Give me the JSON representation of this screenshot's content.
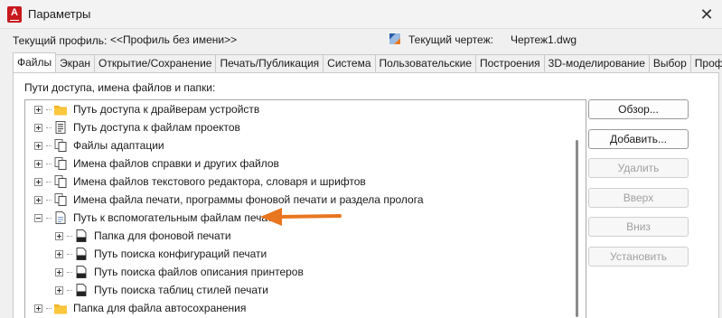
{
  "window": {
    "title": "Параметры",
    "app_icon_letter": "A",
    "close_glyph": "✕"
  },
  "header": {
    "profile_label": "Текущий профиль:",
    "profile_value": "<<Профиль без имени>>",
    "drawing_label": "Текущий чертеж:",
    "drawing_value": "Чертеж1.dwg"
  },
  "tabs": [
    {
      "label": "Файлы",
      "active": true
    },
    {
      "label": "Экран"
    },
    {
      "label": "Открытие/Сохранение"
    },
    {
      "label": "Печать/Публикация"
    },
    {
      "label": "Система"
    },
    {
      "label": "Пользовательские"
    },
    {
      "label": "Построения"
    },
    {
      "label": "3D-моделирование"
    },
    {
      "label": "Выбор"
    },
    {
      "label": "Профили"
    }
  ],
  "panel": {
    "label": "Пути доступа, имена файлов и папки:"
  },
  "tree": {
    "items": [
      {
        "label": "Путь доступа к драйверам устройств",
        "icon": "folder-icon"
      },
      {
        "label": "Путь доступа к файлам проектов",
        "icon": "project-file-icon"
      },
      {
        "label": "Файлы адаптации",
        "icon": "files-stack-icon"
      },
      {
        "label": "Имена файлов справки и других файлов",
        "icon": "files-stack-icon"
      },
      {
        "label": "Имена файлов текстового редактора, словаря и шрифтов",
        "icon": "files-stack-icon"
      },
      {
        "label": "Имена файла печати, программы фоновой печати и раздела пролога",
        "icon": "files-stack-icon"
      },
      {
        "label": "Путь к вспомогательным файлам печати",
        "icon": "document-icon",
        "expanded": true
      },
      {
        "label": "Папка для фоновой печати",
        "icon": "plot-file-icon",
        "child": true
      },
      {
        "label": "Путь поиска конфигураций печати",
        "icon": "plot-file-icon",
        "child": true
      },
      {
        "label": "Путь поиска файлов описания принтеров",
        "icon": "plot-file-icon",
        "child": true
      },
      {
        "label": "Путь поиска таблиц стилей печати",
        "icon": "plot-file-icon",
        "child": true
      },
      {
        "label": "Папка для файла автосохранения",
        "icon": "folder-icon"
      }
    ],
    "plt_badge": "PLT"
  },
  "buttons": {
    "browse": "Обзор...",
    "add": "Добавить...",
    "remove": "Удалить",
    "up": "Вверх",
    "down": "Вниз",
    "set_current": "Установить"
  },
  "colors": {
    "accent_arrow": "#e8761f",
    "folder": "#f5b324",
    "app_icon": "#c8191e"
  }
}
